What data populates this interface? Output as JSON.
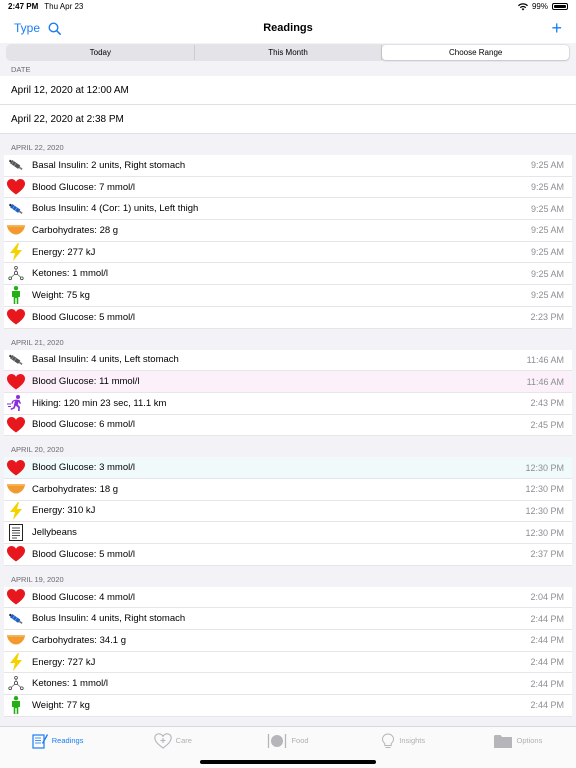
{
  "status": {
    "time": "2:47 PM",
    "date": "Thu Apr 23",
    "battery": "99%"
  },
  "nav": {
    "type_label": "Type",
    "title": "Readings",
    "add_label": "+"
  },
  "segments": [
    {
      "label": "Today",
      "active": false
    },
    {
      "label": "This Month",
      "active": false
    },
    {
      "label": "Choose Range",
      "active": true
    }
  ],
  "range": {
    "header": "DATE",
    "start": "April 12, 2020 at 12:00 AM",
    "end": "April 22, 2020 at 2:38 PM"
  },
  "sections": [
    {
      "title": "APRIL 22, 2020",
      "rows": [
        {
          "icon": "syringe-icon",
          "label": "Basal Insulin: 2 units, Right stomach",
          "time": "9:25 AM"
        },
        {
          "icon": "heart-icon",
          "label": "Blood Glucose: 7 mmol/l",
          "time": "9:25 AM"
        },
        {
          "icon": "syringe-blue-icon",
          "label": "Bolus Insulin: 4 (Cor: 1) units, Left thigh",
          "time": "9:25 AM"
        },
        {
          "icon": "bowl-icon",
          "label": "Carbohydrates: 28 g",
          "time": "9:25 AM"
        },
        {
          "icon": "lightning-icon",
          "label": "Energy: 277 kJ",
          "time": "9:25 AM"
        },
        {
          "icon": "molecule-icon",
          "label": "Ketones: 1 mmol/l",
          "time": "9:25 AM"
        },
        {
          "icon": "person-icon",
          "label": "Weight: 75 kg",
          "time": "9:25 AM"
        },
        {
          "icon": "heart-icon",
          "label": "Blood Glucose: 5 mmol/l",
          "time": "2:23 PM"
        }
      ]
    },
    {
      "title": "APRIL 21, 2020",
      "rows": [
        {
          "icon": "syringe-icon",
          "label": "Basal Insulin: 4 units, Left stomach",
          "time": "11:46 AM"
        },
        {
          "icon": "heart-icon",
          "label": "Blood Glucose: 11 mmol/l",
          "time": "11:46 AM",
          "tint": "pink"
        },
        {
          "icon": "hiker-icon",
          "label": "Hiking: 120 min 23 sec, 11.1 km",
          "time": "2:43 PM"
        },
        {
          "icon": "heart-icon",
          "label": "Blood Glucose: 6 mmol/l",
          "time": "2:45 PM"
        }
      ]
    },
    {
      "title": "APRIL 20, 2020",
      "rows": [
        {
          "icon": "heart-icon",
          "label": "Blood Glucose: 3 mmol/l",
          "time": "12:30 PM",
          "tint": "mint"
        },
        {
          "icon": "bowl-icon",
          "label": "Carbohydrates: 18 g",
          "time": "12:30 PM"
        },
        {
          "icon": "lightning-icon",
          "label": "Energy: 310 kJ",
          "time": "12:30 PM"
        },
        {
          "icon": "document-icon",
          "label": "Jellybeans",
          "time": "12:30 PM"
        },
        {
          "icon": "heart-icon",
          "label": "Blood Glucose: 5 mmol/l",
          "time": "2:37 PM"
        }
      ]
    },
    {
      "title": "APRIL 19, 2020",
      "rows": [
        {
          "icon": "heart-icon",
          "label": "Blood Glucose: 4 mmol/l",
          "time": "2:04 PM"
        },
        {
          "icon": "syringe-blue-icon",
          "label": "Bolus Insulin: 4 units, Right stomach",
          "time": "2:44 PM"
        },
        {
          "icon": "bowl-icon",
          "label": "Carbohydrates: 34.1 g",
          "time": "2:44 PM"
        },
        {
          "icon": "lightning-icon",
          "label": "Energy: 727 kJ",
          "time": "2:44 PM"
        },
        {
          "icon": "molecule-icon",
          "label": "Ketones: 1 mmol/l",
          "time": "2:44 PM"
        },
        {
          "icon": "person-icon",
          "label": "Weight: 77 kg",
          "time": "2:44 PM"
        }
      ]
    }
  ],
  "tabs": [
    {
      "icon": "readings-icon",
      "label": "Readings",
      "active": true
    },
    {
      "icon": "care-icon",
      "label": "Care",
      "active": false
    },
    {
      "icon": "food-icon",
      "label": "Food",
      "active": false
    },
    {
      "icon": "insights-icon",
      "label": "Insights",
      "active": false
    },
    {
      "icon": "folder-icon",
      "label": "Options",
      "active": false
    }
  ],
  "colors": {
    "accent": "#1b7cf2",
    "heart": "#e8161d",
    "lightning": "#f4d200",
    "person": "#23b013",
    "bowl": "#f29a2e",
    "hiker": "#8b2ee0"
  }
}
